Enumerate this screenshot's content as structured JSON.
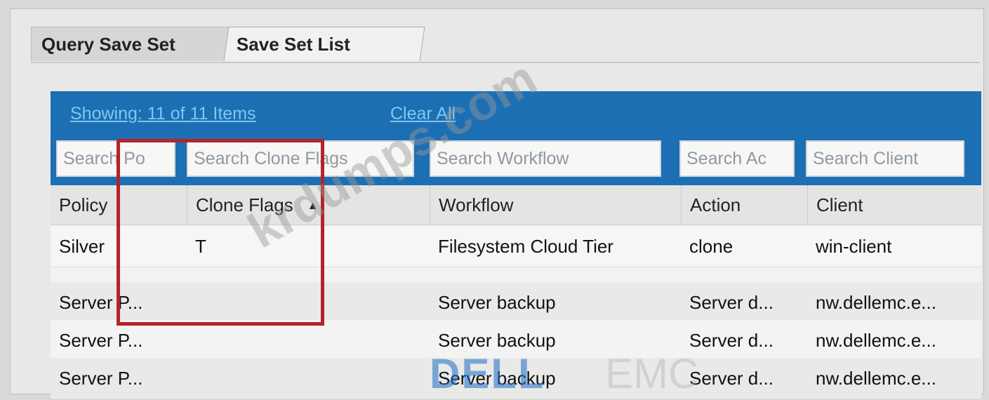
{
  "tabs": [
    {
      "label": "Query Save Set",
      "active": false
    },
    {
      "label": "Save Set List",
      "active": true
    }
  ],
  "toolbar": {
    "showing_label": "Showing: 11 of 11 Items",
    "clear_all_label": "Clear All"
  },
  "search": {
    "policy": "Search Po",
    "clone_flags": "Search Clone Flags",
    "workflow": "Search Workflow",
    "action": "Search Ac",
    "client": "Search Client"
  },
  "columns": [
    "Policy",
    "Clone Flags",
    "Workflow",
    "Action",
    "Client"
  ],
  "sort": {
    "column": "Clone Flags",
    "direction": "ascending"
  },
  "rows": [
    {
      "policy": "Silver",
      "clone_flags": "T",
      "workflow": "Filesystem Cloud Tier",
      "action": "clone",
      "client": "win-client"
    },
    {
      "policy": "Server P...",
      "clone_flags": "",
      "workflow": "Server backup",
      "action": "Server d...",
      "client": "nw.dellemc.e..."
    },
    {
      "policy": "Server P...",
      "clone_flags": "",
      "workflow": "Server backup",
      "action": "Server d...",
      "client": "nw.dellemc.e..."
    },
    {
      "policy": "Server P...",
      "clone_flags": "",
      "workflow": "Server backup",
      "action": "Server d...",
      "client": "nw.dellemc.e..."
    }
  ],
  "watermark": {
    "site": "krdumps.com",
    "brand_left": "DELL",
    "brand_right": "EMC"
  },
  "colors": {
    "header_blue": "#1d6fb4",
    "link": "#7fc7ee",
    "highlight_red": "#b3242a"
  }
}
